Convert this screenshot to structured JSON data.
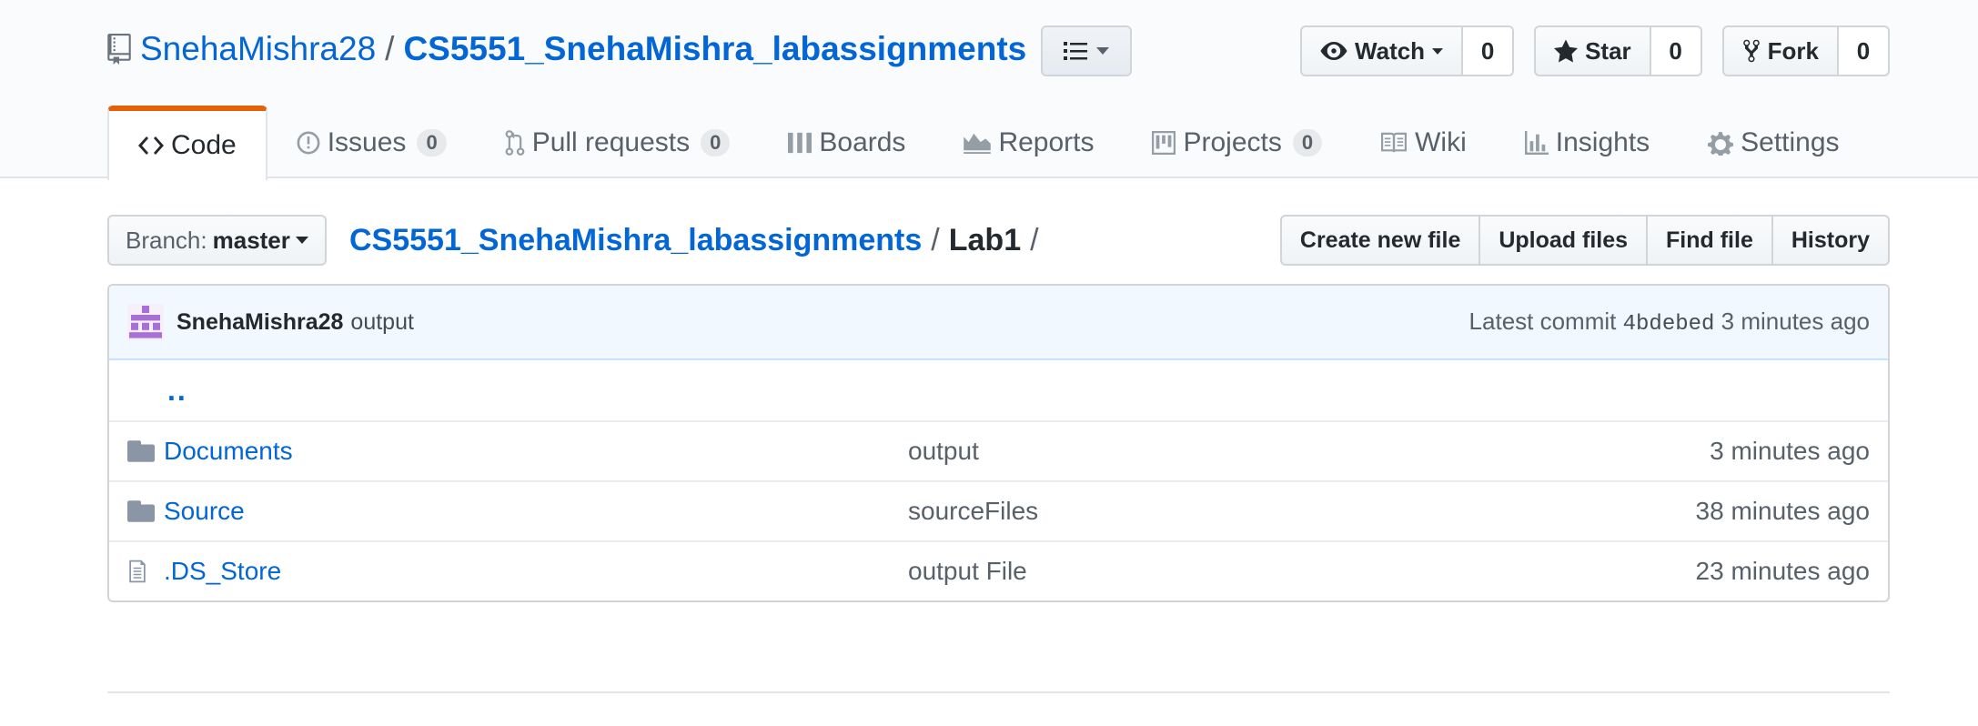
{
  "repo": {
    "owner": "SnehaMishra28",
    "separator": "/",
    "name": "CS5551_SnehaMishra_labassignments"
  },
  "actions": {
    "watch": {
      "label": "Watch",
      "count": "0"
    },
    "star": {
      "label": "Star",
      "count": "0"
    },
    "fork": {
      "label": "Fork",
      "count": "0"
    }
  },
  "tabs": [
    {
      "label": "Code",
      "icon": "code-icon",
      "selected": true
    },
    {
      "label": "Issues",
      "icon": "issue-icon",
      "count": "0"
    },
    {
      "label": "Pull requests",
      "icon": "pull-request-icon",
      "count": "0"
    },
    {
      "label": "Boards",
      "icon": "boards-icon"
    },
    {
      "label": "Reports",
      "icon": "graph-icon"
    },
    {
      "label": "Projects",
      "icon": "project-icon",
      "count": "0"
    },
    {
      "label": "Wiki",
      "icon": "book-icon"
    },
    {
      "label": "Insights",
      "icon": "bar-chart-icon"
    },
    {
      "label": "Settings",
      "icon": "gear-icon"
    }
  ],
  "branch": {
    "label": "Branch:",
    "value": "master"
  },
  "breadcrumb": {
    "root": "CS5551_SnehaMishra_labassignments",
    "sep1": "/",
    "current": "Lab1",
    "sep2": "/"
  },
  "file_actions": {
    "create": "Create new file",
    "upload": "Upload files",
    "find": "Find file",
    "history": "History"
  },
  "commit": {
    "author": "SnehaMishra28",
    "message": "output",
    "latest_label": "Latest commit",
    "sha": "4bdebed",
    "age": "3 minutes ago"
  },
  "files": {
    "parent": "..",
    "rows": [
      {
        "name": "Documents",
        "type": "folder",
        "message": "output",
        "age": "3 minutes ago"
      },
      {
        "name": "Source",
        "type": "folder",
        "message": "sourceFiles",
        "age": "38 minutes ago"
      },
      {
        "name": ".DS_Store",
        "type": "file",
        "message": "output File",
        "age": "23 minutes ago"
      }
    ]
  },
  "colors": {
    "link": "#0366d6",
    "accent_tab": "#e36209",
    "commit_bg": "#f1f8ff"
  }
}
